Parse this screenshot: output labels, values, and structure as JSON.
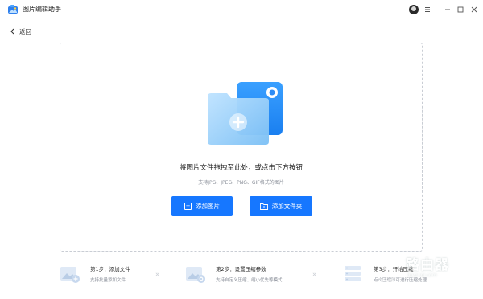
{
  "app": {
    "title": "图片编辑助手"
  },
  "colors": {
    "accent": "#1677ff",
    "border": "#c9cdd4",
    "muted": "#8a8f99"
  },
  "nav": {
    "back_label": "返回"
  },
  "dropzone": {
    "title": "将图片文件拖拽至此处，或点击下方按钮",
    "subtitle": "支持JPG、JPEG、PNG、GIF格式的图片",
    "add_image_label": "添加图片",
    "add_folder_label": "添加文件夹"
  },
  "steps": [
    {
      "title": "第1步：添加文件",
      "desc": "支持批量添加文件",
      "icon": "image-add-icon"
    },
    {
      "title": "第2步：设置压缩参数",
      "desc": "支持自定义压缩、缩小优先等模式",
      "icon": "image-settings-icon"
    },
    {
      "title": "第3步：开始压缩",
      "desc": "点击压缩即可进行压缩处理",
      "icon": "server-stack-icon"
    }
  ],
  "watermark": {
    "text": "路由器",
    "url": "luyouqi.com"
  }
}
